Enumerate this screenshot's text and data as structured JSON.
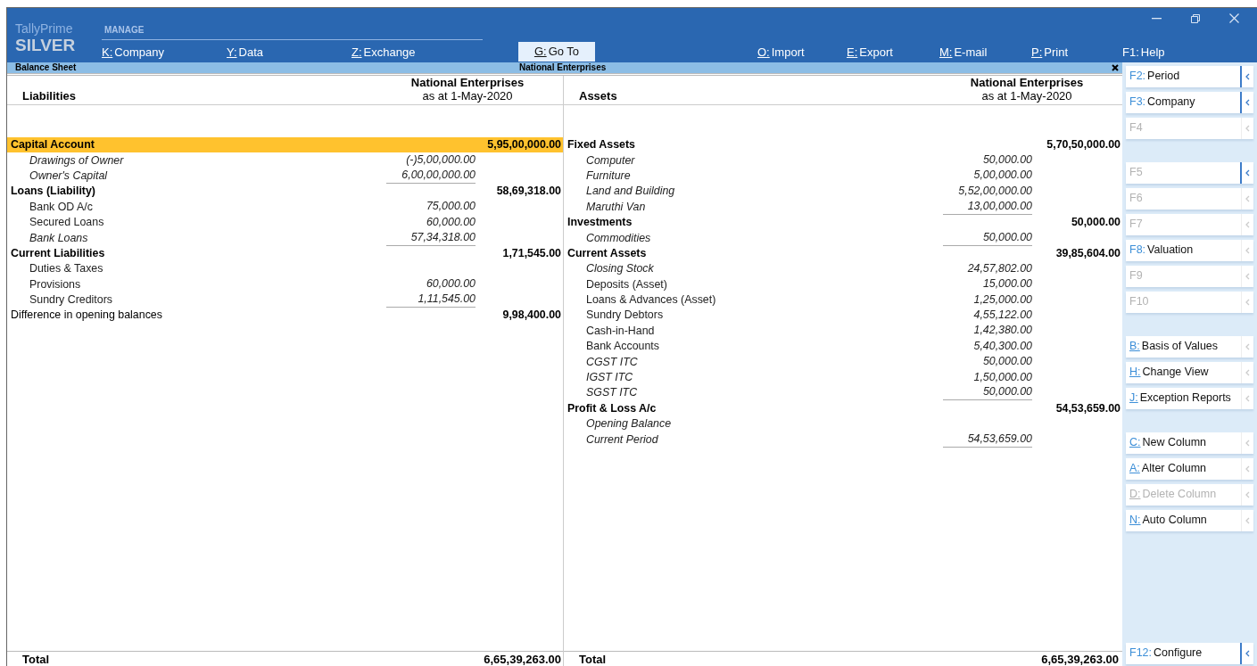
{
  "brand": {
    "product": "TallyPrime",
    "edition": "SILVER"
  },
  "menu_heading": "MANAGE",
  "menu": [
    {
      "key": "K:",
      "label": "Company",
      "underline": true,
      "kind": "link"
    },
    {
      "key": "Y:",
      "label": "Data",
      "underline": true,
      "kind": "link"
    },
    {
      "key": "Z:",
      "label": "Exchange",
      "underline": true,
      "kind": "link"
    },
    {
      "key": "G:",
      "label": "Go To",
      "underline": true,
      "kind": "button"
    },
    {
      "key": "O:",
      "label": "Import",
      "underline": true,
      "kind": "link"
    },
    {
      "key": "E:",
      "label": "Export",
      "underline": true,
      "kind": "link"
    },
    {
      "key": "M:",
      "label": "E-mail",
      "underline": true,
      "kind": "link"
    },
    {
      "key": "P:",
      "label": "Print",
      "underline": true,
      "kind": "link"
    },
    {
      "key": "F1:",
      "label": "Help",
      "underline": false,
      "kind": "link"
    }
  ],
  "report_bar": {
    "title": "Balance Sheet",
    "company": "National Enterprises"
  },
  "sides": [
    {
      "heading": "Liabilities",
      "company": "National Enterprises",
      "date": "as at 1-May-2020",
      "groups": [
        {
          "kind": "group",
          "name": "Capital Account",
          "amount": "5,95,00,000.00",
          "selected": true,
          "items": [
            {
              "name": "Drawings of Owner",
              "amount": "(-)5,00,000.00",
              "italic": true
            },
            {
              "name": "Owner's Capital",
              "amount": "6,00,00,000.00",
              "italic": true
            }
          ]
        },
        {
          "kind": "group",
          "name": "Loans (Liability)",
          "amount": "58,69,318.00",
          "selected": false,
          "items": [
            {
              "name": "Bank OD A/c",
              "amount": "75,000.00",
              "italic": false
            },
            {
              "name": "Secured Loans",
              "amount": "60,000.00",
              "italic": false
            },
            {
              "name": "Bank Loans",
              "amount": "57,34,318.00",
              "italic": true
            }
          ]
        },
        {
          "kind": "group",
          "name": "Current Liabilities",
          "amount": "1,71,545.00",
          "selected": false,
          "items": [
            {
              "name": "Duties & Taxes",
              "italic": false
            },
            {
              "name": "Provisions",
              "amount": "60,000.00",
              "italic": false
            },
            {
              "name": "Sundry Creditors",
              "amount": "1,11,545.00",
              "italic": false
            }
          ]
        },
        {
          "kind": "plain",
          "name": "Difference in opening balances",
          "amount": "9,98,400.00",
          "selected": false
        }
      ],
      "total_label": "Total",
      "total": "6,65,39,263.00"
    },
    {
      "heading": "Assets",
      "company": "National Enterprises",
      "date": "as at 1-May-2020",
      "groups": [
        {
          "kind": "group",
          "name": "Fixed Assets",
          "amount": "5,70,50,000.00",
          "selected": false,
          "items": [
            {
              "name": "Computer",
              "amount": "50,000.00",
              "italic": true
            },
            {
              "name": "Furniture",
              "amount": "5,00,000.00",
              "italic": true
            },
            {
              "name": "Land and Building",
              "amount": "5,52,00,000.00",
              "italic": true
            },
            {
              "name": "Maruthi Van",
              "amount": "13,00,000.00",
              "italic": true
            }
          ]
        },
        {
          "kind": "group",
          "name": "Investments",
          "amount": "50,000.00",
          "selected": false,
          "items": [
            {
              "name": "Commodities",
              "amount": "50,000.00",
              "italic": true
            }
          ]
        },
        {
          "kind": "group",
          "name": "Current Assets",
          "amount": "39,85,604.00",
          "selected": false,
          "items": [
            {
              "name": "Closing Stock",
              "amount": "24,57,802.00",
              "italic": true
            },
            {
              "name": "Deposits (Asset)",
              "amount": "15,000.00",
              "italic": false
            },
            {
              "name": "Loans & Advances (Asset)",
              "amount": "1,25,000.00",
              "italic": false
            },
            {
              "name": "Sundry Debtors",
              "amount": "4,55,122.00",
              "italic": false
            },
            {
              "name": "Cash-in-Hand",
              "amount": "1,42,380.00",
              "italic": false
            },
            {
              "name": "Bank Accounts",
              "amount": "5,40,300.00",
              "italic": false
            },
            {
              "name": "CGST ITC",
              "amount": "50,000.00",
              "italic": true
            },
            {
              "name": "IGST ITC",
              "amount": "1,50,000.00",
              "italic": true
            },
            {
              "name": "SGST ITC",
              "amount": "50,000.00",
              "italic": true
            }
          ]
        },
        {
          "kind": "group",
          "name": "Profit & Loss A/c",
          "amount": "54,53,659.00",
          "selected": false,
          "items": [
            {
              "name": "Opening Balance",
              "italic": true
            },
            {
              "name": "Current Period",
              "amount": "54,53,659.00",
              "italic": true
            }
          ]
        }
      ],
      "total_label": "Total",
      "total": "6,65,39,263.00"
    }
  ],
  "side_panel": [
    [
      {
        "key": "F2:",
        "label": "Period",
        "disabled": false,
        "underline": false,
        "expanded": true
      },
      {
        "key": "F3:",
        "label": "Company",
        "disabled": false,
        "underline": false,
        "expanded": true
      },
      {
        "key": "F4",
        "disabled": true,
        "underline": false,
        "expanded": false
      }
    ],
    [
      {
        "key": "F5",
        "disabled": true,
        "underline": false,
        "expanded": true
      },
      {
        "key": "F6",
        "disabled": true,
        "underline": false,
        "expanded": false
      },
      {
        "key": "F7",
        "disabled": true,
        "underline": false,
        "expanded": false
      },
      {
        "key": "F8:",
        "label": "Valuation",
        "disabled": false,
        "underline": false,
        "expanded": false
      },
      {
        "key": "F9",
        "disabled": true,
        "underline": false,
        "expanded": false
      },
      {
        "key": "F10",
        "disabled": true,
        "underline": false,
        "expanded": false
      }
    ],
    [
      {
        "key": "B:",
        "label": "Basis of Values",
        "disabled": false,
        "underline": true,
        "expanded": false
      },
      {
        "key": "H:",
        "label": "Change View",
        "disabled": false,
        "underline": true,
        "expanded": false
      },
      {
        "key": "J:",
        "label": "Exception Reports",
        "disabled": false,
        "underline": true,
        "expanded": false
      }
    ],
    [
      {
        "key": "C:",
        "label": "New Column",
        "disabled": false,
        "underline": true,
        "expanded": false
      },
      {
        "key": "A:",
        "label": "Alter Column",
        "disabled": false,
        "underline": true,
        "expanded": false
      },
      {
        "key": "D:",
        "label": "Delete Column",
        "disabled": true,
        "underline": true,
        "expanded": false
      },
      {
        "key": "N:",
        "label": "Auto Column",
        "disabled": false,
        "underline": true,
        "expanded": false
      }
    ]
  ],
  "configure": {
    "key": "F12:",
    "label": "Configure",
    "disabled": false,
    "underline": false,
    "expanded": true
  }
}
